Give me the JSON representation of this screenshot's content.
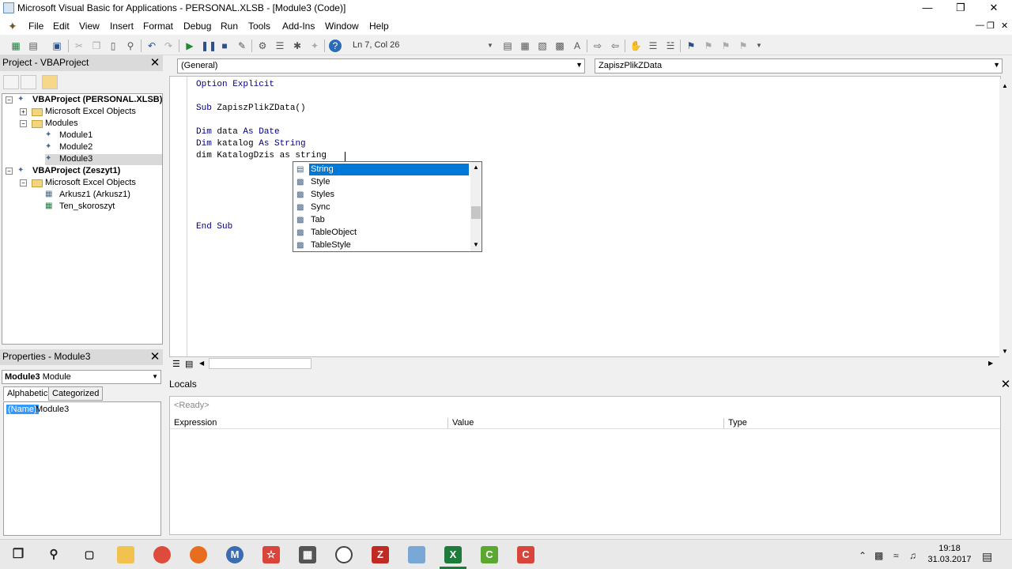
{
  "window": {
    "title": "Microsoft Visual Basic for Applications - PERSONAL.XLSB - [Module3 (Code)]"
  },
  "menus": [
    "File",
    "Edit",
    "View",
    "Insert",
    "Format",
    "Debug",
    "Run",
    "Tools",
    "Add-Ins",
    "Window",
    "Help"
  ],
  "toolbar": {
    "position": "Ln 7, Col 26"
  },
  "project": {
    "title": "Project - VBAProject",
    "tree": [
      {
        "label": "VBAProject (PERSONAL.XLSB)",
        "bold": true
      },
      {
        "label": "Microsoft Excel Objects"
      },
      {
        "label": "Modules"
      },
      {
        "label": "Module1"
      },
      {
        "label": "Module2"
      },
      {
        "label": "Module3"
      },
      {
        "label": "VBAProject (Zeszyt1)",
        "bold": true
      },
      {
        "label": "Microsoft Excel Objects"
      },
      {
        "label": "Arkusz1 (Arkusz1)"
      },
      {
        "label": "Ten_skoroszyt"
      }
    ]
  },
  "properties": {
    "title": "Properties - Module3",
    "object_name": "Module3",
    "object_type": "Module",
    "tabs": [
      "Alphabetic",
      "Categorized"
    ],
    "rows": [
      {
        "name": "(Name)",
        "value": "Module3"
      }
    ]
  },
  "code": {
    "object_combo": "(General)",
    "proc_combo": "ZapiszPlikZData",
    "lines": [
      {
        "kw": "Option Explicit",
        "rest": ""
      },
      {
        "kw": "",
        "rest": ""
      },
      {
        "kw": "Sub",
        "rest": " ZapiszPlikZData()"
      },
      {
        "kw": "",
        "rest": ""
      },
      {
        "kw": "Dim",
        "rest": " data ",
        "kw2": "As Date"
      },
      {
        "kw": "Dim",
        "rest": " katalog ",
        "kw2": "As String"
      },
      {
        "kw": "",
        "rest": "dim KatalogDzis as string"
      },
      {
        "kw": "",
        "rest": ""
      },
      {
        "kw": "",
        "rest": ""
      },
      {
        "kw": "",
        "rest": ""
      },
      {
        "kw": "",
        "rest": ""
      },
      {
        "kw": "",
        "rest": ""
      },
      {
        "kw": "End Sub",
        "rest": ""
      }
    ]
  },
  "autocomplete": {
    "items": [
      "String",
      "Style",
      "Styles",
      "Sync",
      "Tab",
      "TableObject",
      "TableStyle"
    ],
    "selected": "String"
  },
  "locals": {
    "title": "Locals",
    "status": "<Ready>",
    "columns": [
      "Expression",
      "Value",
      "Type"
    ]
  },
  "taskbar": {
    "time": "19:18",
    "date": "31.03.2017"
  },
  "colors": {
    "keyword": "#00007f",
    "selection": "#0078d7",
    "name_highlight": "#3399ff"
  }
}
